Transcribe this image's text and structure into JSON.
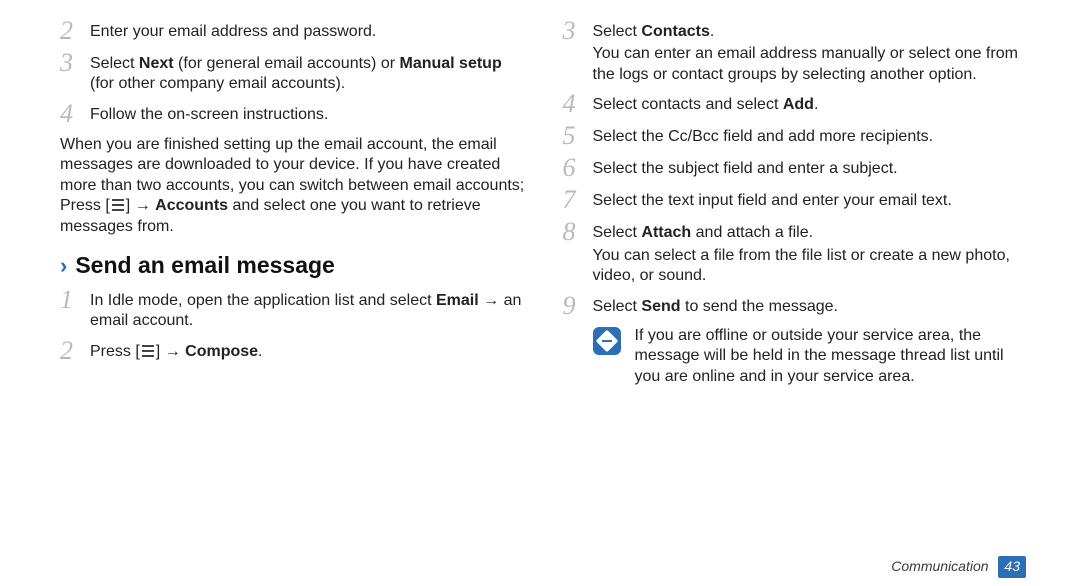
{
  "left": {
    "step2": "Enter your email address and password.",
    "step3a": "Select ",
    "step3b": "Next",
    "step3c": " (for general email accounts) or ",
    "step3d": "Manual setup",
    "step3e": " (for other company email accounts).",
    "step4": "Follow the on-screen instructions.",
    "paraA": "When you are finished setting up the email account, the email messages are downloaded to your device. If you have created more than two accounts, you can switch between email accounts; Press [",
    "paraB": "] → ",
    "paraC": "Accounts",
    "paraD": " and select one you want to retrieve messages from.",
    "heading": "Send an email message",
    "s1a": "In Idle mode, open the application list and select ",
    "s1b": "Email",
    "s1c": " → an email account.",
    "s2a": "Press [",
    "s2b": "] → ",
    "s2c": "Compose",
    "s2d": "."
  },
  "right": {
    "s3a": "Select ",
    "s3b": "Contacts",
    "s3c": ".",
    "s3sub": "You can enter an email address manually or select one from the logs or contact groups by selecting another option.",
    "s4a": "Select contacts and select ",
    "s4b": "Add",
    "s4c": ".",
    "s5": "Select the Cc/Bcc field and add more recipients.",
    "s6": "Select the subject field and enter a subject.",
    "s7": "Select the text input field and enter your email text.",
    "s8a": "Select ",
    "s8b": "Attach",
    "s8c": " and attach a file.",
    "s8sub": "You can select a file from the file list or create a new photo, video, or sound.",
    "s9a": "Select ",
    "s9b": "Send",
    "s9c": " to send the message.",
    "note": "If you are offline or outside your service area, the message will be held in the message thread list until you are online and in your service area."
  },
  "footer": {
    "label": "Communication",
    "page": "43"
  }
}
